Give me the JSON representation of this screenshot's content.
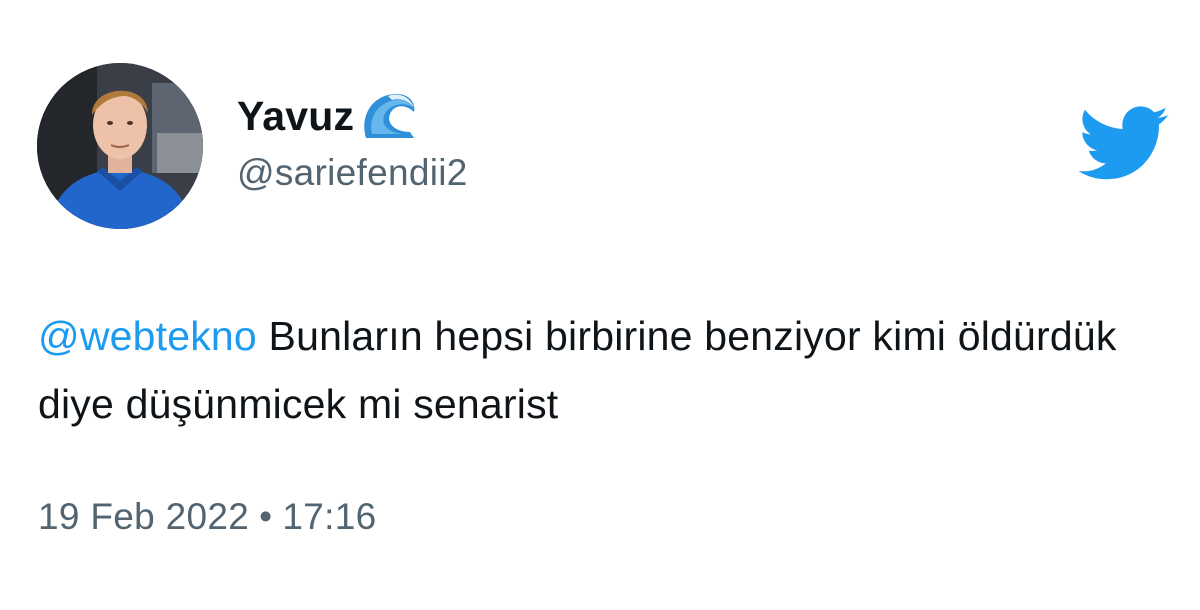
{
  "author": {
    "display_name": "Yavuz",
    "emoji_name": "water-wave-emoji",
    "handle": "@sariefendii2"
  },
  "tweet": {
    "mention": "@webtekno",
    "text": " Bunların hepsi birbirine benziyor kimi öldürdük diye düşünmicek mi senarist"
  },
  "meta": {
    "date": "19 Feb 2022",
    "separator": "•",
    "time": "17:16"
  },
  "colors": {
    "accent": "#1d9bf0",
    "text": "#0f1419",
    "secondary": "#536471"
  },
  "icons": {
    "brand": "twitter-bird-icon"
  }
}
